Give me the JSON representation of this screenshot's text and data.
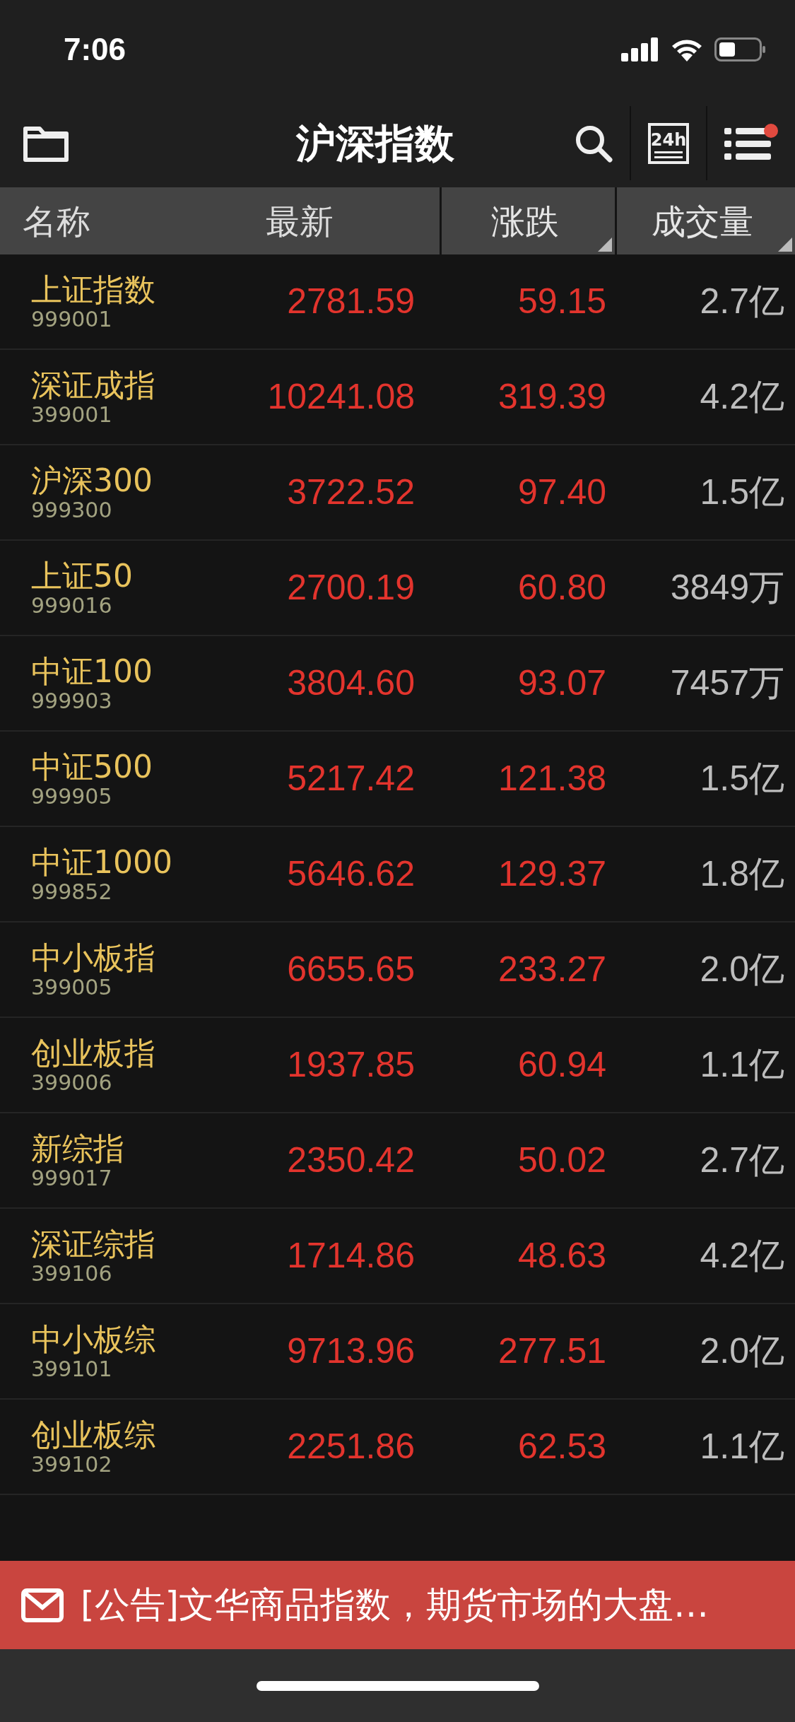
{
  "status_bar": {
    "time": "7:06"
  },
  "nav": {
    "title": "沪深指数",
    "calendar_label": "24h",
    "menu_notification": true
  },
  "table": {
    "columns": [
      {
        "label": "名称"
      },
      {
        "label": "最新"
      },
      {
        "label": "涨跌",
        "sortable": true
      },
      {
        "label": "成交量",
        "sortable": true
      }
    ],
    "rows": [
      {
        "name": "上证指数",
        "code": "999001",
        "price": "2781.59",
        "change": "59.15",
        "volume": "2.7亿"
      },
      {
        "name": "深证成指",
        "code": "399001",
        "price": "10241.08",
        "change": "319.39",
        "volume": "4.2亿"
      },
      {
        "name": "沪深300",
        "code": "999300",
        "price": "3722.52",
        "change": "97.40",
        "volume": "1.5亿"
      },
      {
        "name": "上证50",
        "code": "999016",
        "price": "2700.19",
        "change": "60.80",
        "volume": "3849万"
      },
      {
        "name": "中证100",
        "code": "999903",
        "price": "3804.60",
        "change": "93.07",
        "volume": "7457万"
      },
      {
        "name": "中证500",
        "code": "999905",
        "price": "5217.42",
        "change": "121.38",
        "volume": "1.5亿"
      },
      {
        "name": "中证1000",
        "code": "999852",
        "price": "5646.62",
        "change": "129.37",
        "volume": "1.8亿"
      },
      {
        "name": "中小板指",
        "code": "399005",
        "price": "6655.65",
        "change": "233.27",
        "volume": "2.0亿"
      },
      {
        "name": "创业板指",
        "code": "399006",
        "price": "1937.85",
        "change": "60.94",
        "volume": "1.1亿"
      },
      {
        "name": "新综指",
        "code": "999017",
        "price": "2350.42",
        "change": "50.02",
        "volume": "2.7亿"
      },
      {
        "name": "深证综指",
        "code": "399106",
        "price": "1714.86",
        "change": "48.63",
        "volume": "4.2亿"
      },
      {
        "name": "中小板综",
        "code": "399101",
        "price": "9713.96",
        "change": "277.51",
        "volume": "2.0亿"
      },
      {
        "name": "创业板综",
        "code": "399102",
        "price": "2251.86",
        "change": "62.53",
        "volume": "1.1亿"
      }
    ]
  },
  "announcement": {
    "text": "[公告]文华商品指数，期货市场的大盘…"
  }
}
